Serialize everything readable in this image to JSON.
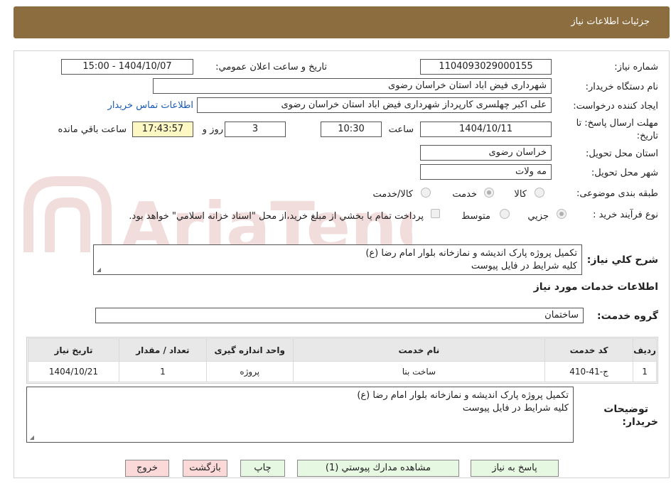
{
  "header": {
    "title": "جزئیات اطلاعات نیاز"
  },
  "watermark": {
    "text": "AriaTender.neT"
  },
  "form": {
    "need_number_label": "شماره نیاز:",
    "need_number": "1104093029000155",
    "announce_label": "تاریخ و ساعت اعلان عمومي:",
    "announce_value": "1404/10/07 - 15:00",
    "buyer_org_label": "نام دستگاه خريدار:",
    "buyer_org": "شهرداری فیض اباد استان خراسان رضوی",
    "creator_label": "ايجاد كننده درخواست:",
    "creator": "علی اکبر چهلسری کارپرداز شهرداری فیض اباد استان خراسان رضوی",
    "contact_link": "اطلاعات تماس خريدار",
    "deadline_label_1": "مهلت ارسال پاسخ: تا",
    "deadline_label_2": "تاريخ:",
    "deadline_date": "1404/10/11",
    "time_label": "ساعت",
    "deadline_time": "10:30",
    "days_value": "3",
    "days_label": "روز و",
    "remaining_time": "17:43:57",
    "remaining_label": "ساعت باقي مانده",
    "province_label": "استان محل تحويل:",
    "province": "خراسان رضوی",
    "city_label": "شهر محل تحويل:",
    "city": "مه ولات",
    "category_label": "طبقه بندی موضوعی:",
    "category_options": [
      "كالا",
      "خدمت",
      "كالا/خدمت"
    ],
    "process_label": "نوع فرآيند خريد :",
    "process_options": [
      "جزيي",
      "متوسط"
    ],
    "process_note": "پرداخت تمام يا بخشي از مبلغ خريد،از محل \"اسناد خزانه اسلامي\" خواهد بود."
  },
  "summary": {
    "label": "شرح كلي نياز:",
    "line1": "تکمیل پروژه پارک اندیشه و نمازخانه بلوار امام رضا (ع)",
    "line2": "کلیه شرایط در فایل پیوست"
  },
  "services": {
    "title": "اطلاعات خدمات مورد نياز",
    "group_label": "گروه خدمت:",
    "group_value": "ساختمان",
    "columns": [
      "رديف",
      "كد خدمت",
      "نام خدمت",
      "واحد اندازه گيری",
      "تعداد / مقدار",
      "تاريخ نياز"
    ],
    "rows": [
      [
        "1",
        "ج-41-410",
        "ساخت بنا",
        "پروژه",
        "1",
        "1404/10/21"
      ]
    ]
  },
  "buyer_notes": {
    "label_1": "توضيحات",
    "label_2": "خريدار:",
    "line1": "تکمیل پروژه پارک اندیشه و نمازخانه بلوار امام رضا (ع)",
    "line2": "کلیه شرایط در فایل پیوست"
  },
  "buttons": {
    "reply": "پاسخ به نياز",
    "attachments": "مشاهده مدارك پيوستي (1)",
    "print": "چاپ",
    "back": "بازگشت",
    "exit": "خروج"
  }
}
